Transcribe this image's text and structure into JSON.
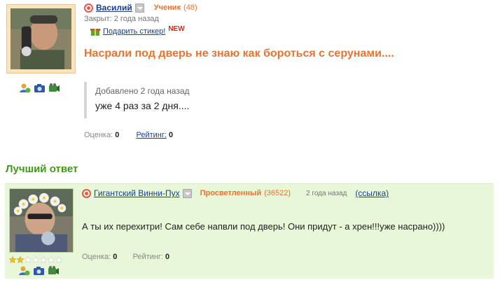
{
  "question": {
    "username": "Василий",
    "rank": "Ученик",
    "points": "(48)",
    "closed": "Закрыт: 2 года назад",
    "gift_link": "Подарить стикер!",
    "new_badge": "NEW",
    "title": "Насрали под дверь не знаю как бороться с серунами....",
    "added_label": "Добавлено 2 года назад",
    "added_text": "уже 4 раз за 2 дня....",
    "score_label": "Оценка:",
    "score_value": "0",
    "rating_label": "Рейтинг:",
    "rating_value": "0"
  },
  "best_answer": {
    "section_title": "Лучший ответ",
    "username": "Гигантский Винни-Пух",
    "rank": "Просветленный",
    "points": "(36522)",
    "time": "2 года назад",
    "link_label": "(ссылка)",
    "answer_text": "А ты их перехитри! Сам себе напвли под дверь! Они придут - а хрен!!!уже насрано))))",
    "score_label": "Оценка:",
    "score_value": "0",
    "rating_label": "Рейтинг:",
    "rating_value": "0",
    "stars_filled": 2,
    "stars_total": 7
  },
  "colors": {
    "link_blue": "#1a3e8c",
    "accent_orange": "#e8742e",
    "best_green": "#3e9b16",
    "best_bg": "#e7f7d8"
  }
}
